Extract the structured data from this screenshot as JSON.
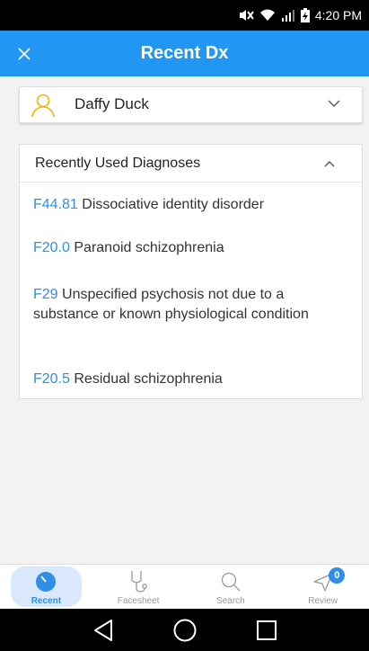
{
  "status_bar": {
    "time": "4:20 PM"
  },
  "app_bar": {
    "title": "Recent Dx"
  },
  "patient": {
    "name": "Daffy Duck"
  },
  "diagnoses_section": {
    "header": "Recently Used Diagnoses",
    "items": [
      {
        "code": "F44.81",
        "description": "Dissociative identity disorder"
      },
      {
        "code": "F20.0",
        "description": "Paranoid schizophrenia"
      },
      {
        "code": "F29",
        "description": "Unspecified psychosis not due to a substance or known physiological condition"
      },
      {
        "code": "F20.5",
        "description": "Residual schizophrenia"
      }
    ]
  },
  "tabs": [
    {
      "label": "Recent",
      "icon": "clock-icon",
      "active": true
    },
    {
      "label": "Facesheet",
      "icon": "stethoscope-icon",
      "active": false
    },
    {
      "label": "Search",
      "icon": "search-icon",
      "active": false
    },
    {
      "label": "Review",
      "icon": "send-icon",
      "active": false,
      "badge": "0"
    }
  ],
  "colors": {
    "primary": "#2196f3",
    "accent_link": "#2f8fe6",
    "avatar": "#f5b400"
  }
}
